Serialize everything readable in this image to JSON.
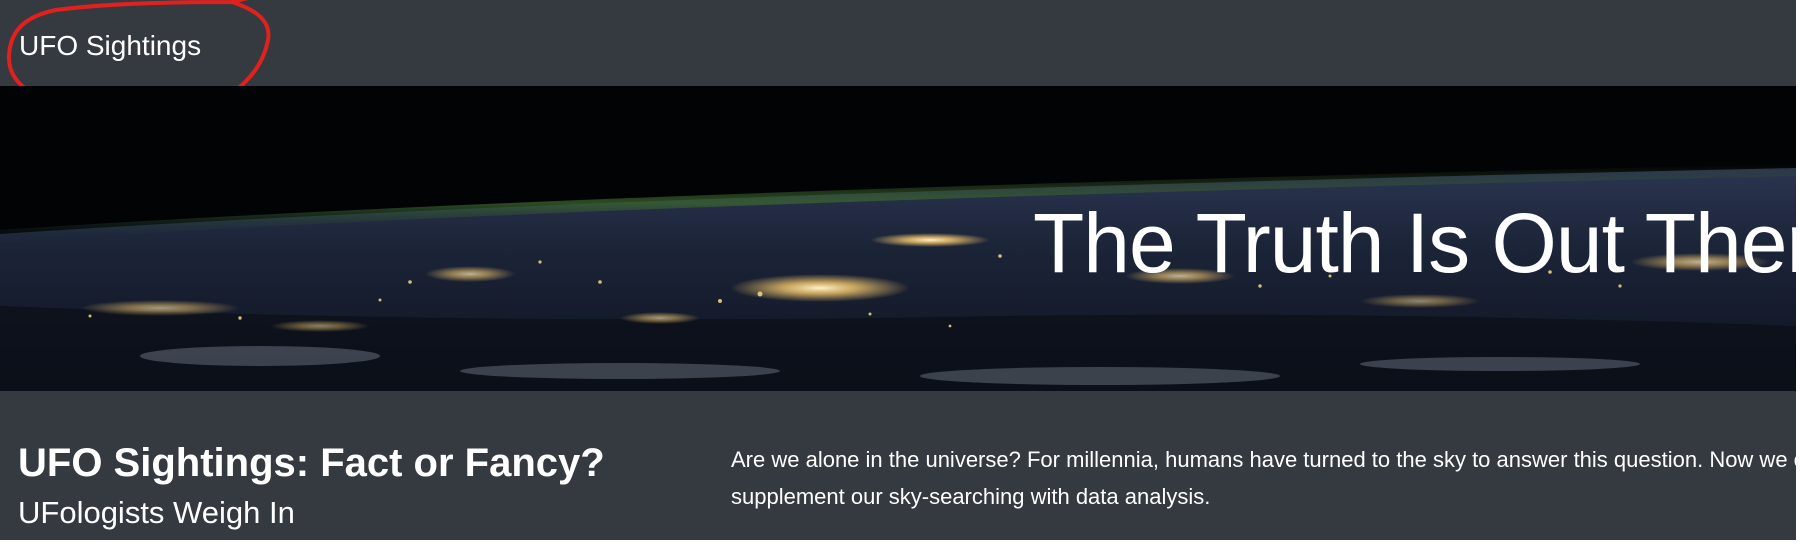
{
  "navbar": {
    "brand": "UFO Sightings"
  },
  "hero": {
    "title": "The Truth Is Out There"
  },
  "content": {
    "heading": "UFO Sightings: Fact or Fancy?",
    "subheading": "UFologists Weigh In",
    "intro": "Are we alone in the universe? For millennia, humans have turned to the sky to answer this question. Now we can supplement our sky-searching with data analysis."
  },
  "colors": {
    "navbar_bg": "#343a40",
    "annotation": "#e0211d",
    "text": "#ffffff"
  }
}
